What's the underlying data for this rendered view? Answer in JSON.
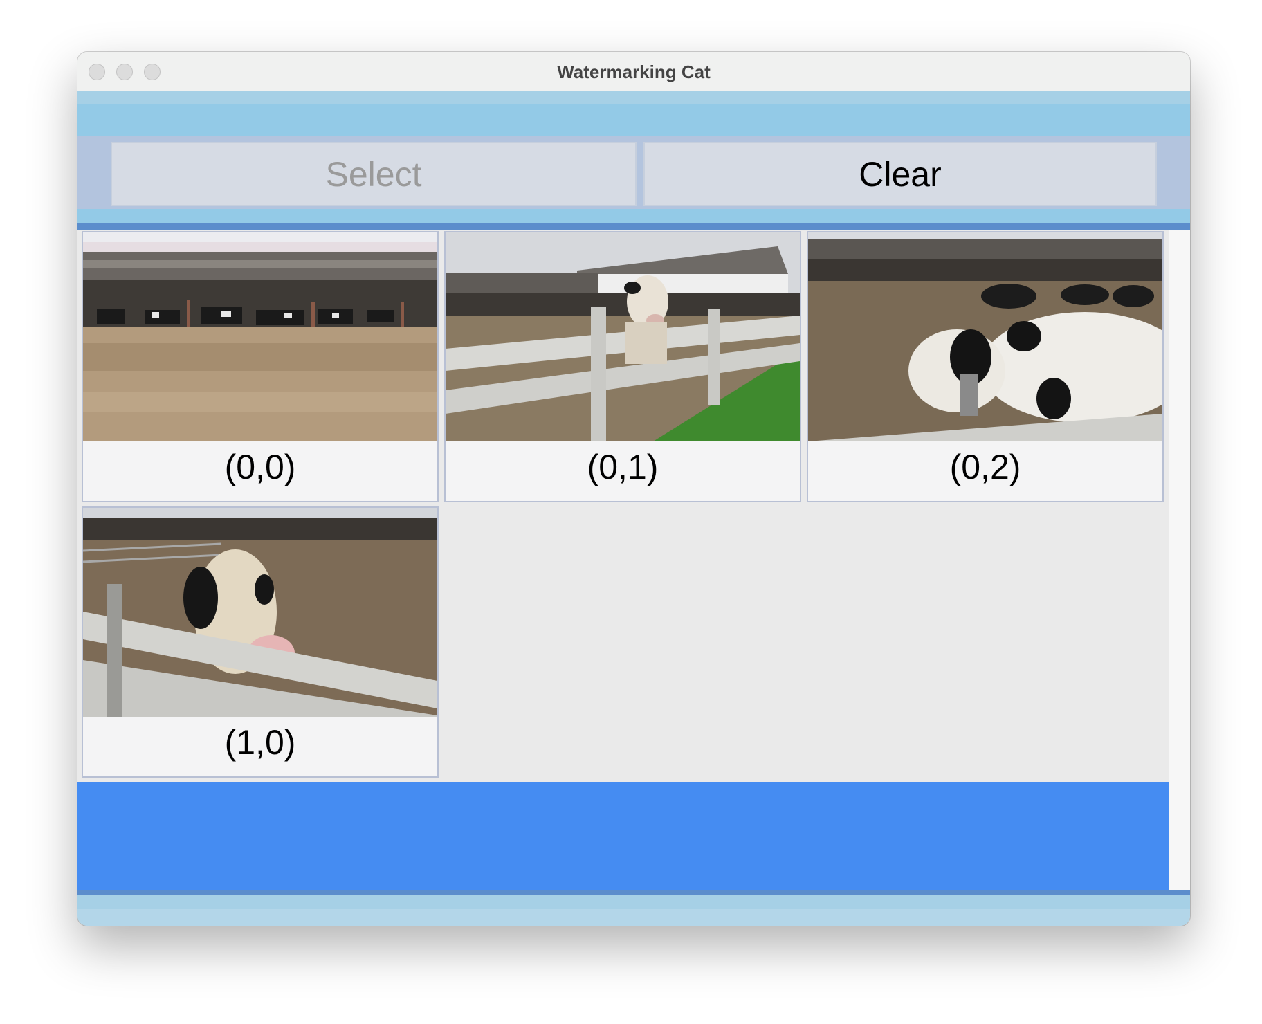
{
  "window": {
    "title": "Watermarking Cat"
  },
  "toolbar": {
    "select_label": "Select",
    "clear_label": "Clear"
  },
  "grid": {
    "cells": [
      {
        "caption": "(0,0)"
      },
      {
        "caption": "(0,1)"
      },
      {
        "caption": "(0,2)"
      },
      {
        "caption": "(1,0)"
      }
    ]
  },
  "colors": {
    "toolbar": "#b3c4de",
    "bottom_bar": "#458cf2",
    "band_light": "#a6d0e6",
    "band_mid": "#93cae7",
    "band_dark": "#5b8dcc"
  }
}
